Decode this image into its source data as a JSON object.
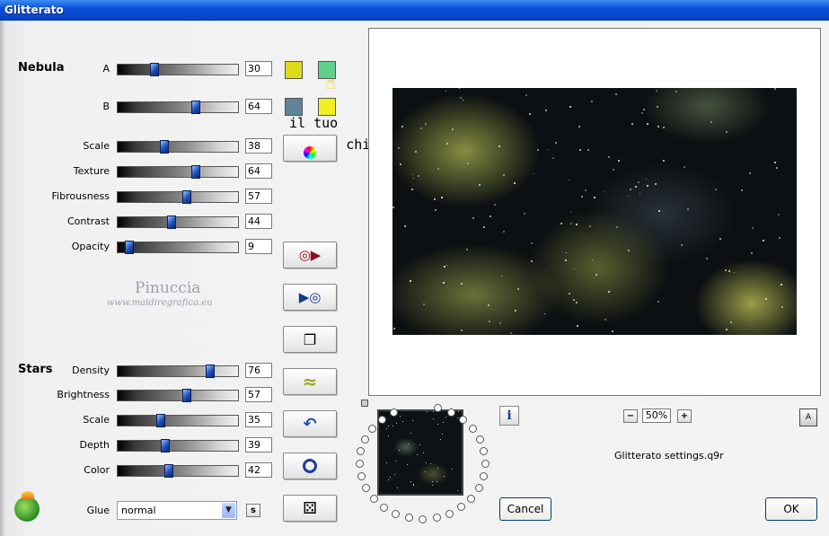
{
  "window": {
    "title": "Glitterato"
  },
  "nebula": {
    "section_label": "Nebula",
    "sliders": [
      {
        "label": "A",
        "value": "30",
        "level": 0.3
      },
      {
        "label": "B",
        "value": "64",
        "level": 0.64
      },
      {
        "label": "Scale",
        "value": "38",
        "level": 0.38
      },
      {
        "label": "Texture",
        "value": "64",
        "level": 0.64
      },
      {
        "label": "Fibrousness",
        "value": "57",
        "level": 0.57
      },
      {
        "label": "Contrast",
        "value": "44",
        "level": 0.44
      },
      {
        "label": "Opacity",
        "value": "9",
        "level": 0.09
      }
    ],
    "colors": {
      "a1": "#e0da1c",
      "a2": "#5fd08c",
      "b1": "#5f8398",
      "b2": "#f0f020"
    }
  },
  "stars": {
    "section_label": "Stars",
    "sliders": [
      {
        "label": "Density",
        "value": "76",
        "level": 0.76
      },
      {
        "label": "Brightness",
        "value": "57",
        "level": 0.57
      },
      {
        "label": "Scale",
        "value": "35",
        "level": 0.35
      },
      {
        "label": "Depth",
        "value": "39",
        "level": 0.39
      },
      {
        "label": "Color",
        "value": "42",
        "level": 0.42
      }
    ]
  },
  "glue": {
    "label": "Glue",
    "value": "normal",
    "s_label": "s"
  },
  "annotation": {
    "line1": "il tuo",
    "line2": "colore chiaro"
  },
  "watermark": {
    "name": "Pinuccia",
    "site": "www.maidiregrafica.eu"
  },
  "zoom": {
    "value": "50%",
    "minus": "−",
    "plus": "+"
  },
  "info_icon": "i",
  "a_icon": "A",
  "settings_file": "Glitterato settings.q9r",
  "buttons": {
    "cancel": "Cancel",
    "ok": "OK"
  },
  "icons": [
    "color-picker-icon",
    "save-preset-icon",
    "load-preset-icon",
    "copy-icon",
    "wave-icon",
    "undo-icon",
    "ring-icon",
    "dice-icon",
    "app-logo-icon"
  ]
}
